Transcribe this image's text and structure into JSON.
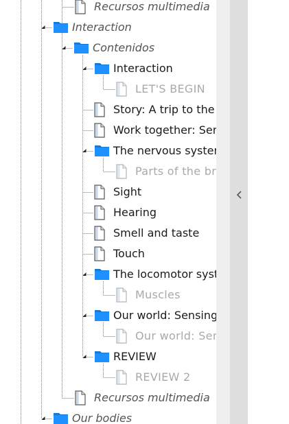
{
  "tree": {
    "items": [
      {
        "label": "Recursos multimedia",
        "icon": "document-icon",
        "style": "italic"
      },
      {
        "label": "Interaction",
        "icon": "folder-icon",
        "style": "italic"
      },
      {
        "label": "Contenidos",
        "icon": "folder-icon",
        "style": "italic"
      },
      {
        "label": "Interaction",
        "icon": "folder-icon",
        "style": "normal"
      },
      {
        "label": "LET'S BEGIN",
        "icon": "document-icon",
        "style": "dim"
      },
      {
        "label": "Story: A trip to the",
        "icon": "document-icon",
        "style": "normal"
      },
      {
        "label": "Work together: Sen",
        "icon": "document-icon",
        "style": "normal"
      },
      {
        "label": "The nervous system",
        "icon": "folder-icon",
        "style": "normal"
      },
      {
        "label": "Parts of the bra",
        "icon": "document-icon",
        "style": "dim"
      },
      {
        "label": "Sight",
        "icon": "document-icon",
        "style": "normal"
      },
      {
        "label": "Hearing",
        "icon": "document-icon",
        "style": "normal"
      },
      {
        "label": "Smell and taste",
        "icon": "document-icon",
        "style": "normal"
      },
      {
        "label": "Touch",
        "icon": "document-icon",
        "style": "normal"
      },
      {
        "label": "The locomotor syst",
        "icon": "folder-icon",
        "style": "normal"
      },
      {
        "label": "Muscles",
        "icon": "document-icon",
        "style": "dim"
      },
      {
        "label": "Our world: Sensing",
        "icon": "folder-icon",
        "style": "normal"
      },
      {
        "label": "Our world: Sens",
        "icon": "document-icon",
        "style": "dim"
      },
      {
        "label": "REVIEW",
        "icon": "folder-icon",
        "style": "normal"
      },
      {
        "label": "REVIEW 2",
        "icon": "document-icon",
        "style": "dim"
      },
      {
        "label": "Recursos multimedia",
        "icon": "document-icon",
        "style": "italic"
      },
      {
        "label": "Our bodies",
        "icon": "folder-icon",
        "style": "italic"
      }
    ]
  },
  "colors": {
    "folder": "#1e90ff",
    "folder_dark": "#1478d4",
    "connector": "#7a7a7a",
    "dim_text": "#a9a9a9"
  },
  "collapse_bar": {
    "icon": "chevron-left-icon"
  }
}
